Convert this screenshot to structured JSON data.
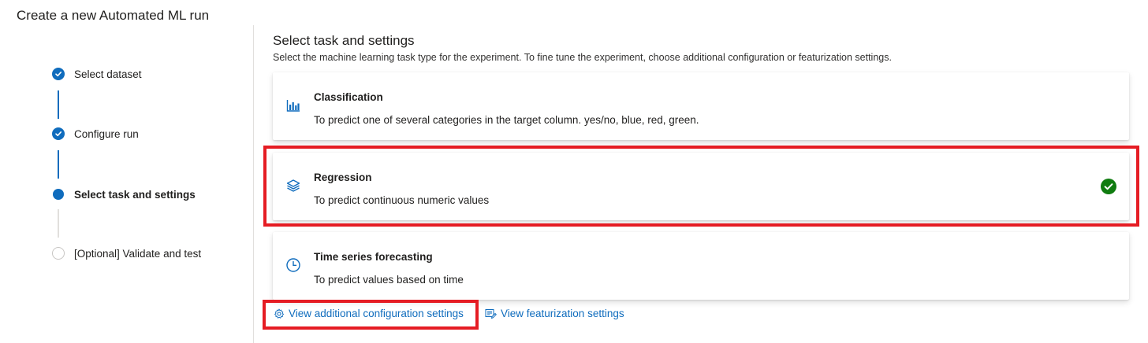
{
  "page": {
    "title": "Create a new Automated ML run"
  },
  "stepper": {
    "steps": [
      {
        "label": "Select dataset",
        "state": "done"
      },
      {
        "label": "Configure run",
        "state": "done"
      },
      {
        "label": "Select task and settings",
        "state": "current"
      },
      {
        "label": "[Optional] Validate and test",
        "state": "pending"
      }
    ]
  },
  "main": {
    "title": "Select task and settings",
    "description": "Select the machine learning task type for the experiment. To fine tune the experiment, choose additional configuration or featurization settings.",
    "tasks": [
      {
        "title": "Classification",
        "description": "To predict one of several categories in the target column. yes/no, blue, red, green.",
        "icon": "bar-chart-icon",
        "selected": false
      },
      {
        "title": "Regression",
        "description": "To predict continuous numeric values",
        "icon": "layers-icon",
        "selected": true
      },
      {
        "title": "Time series forecasting",
        "description": "To predict values based on time",
        "icon": "clock-icon",
        "selected": false
      }
    ],
    "links": {
      "config_label": "View additional configuration settings",
      "featurization_label": "View featurization settings"
    }
  },
  "colors": {
    "accent": "#0f6cbd",
    "success": "#107c10",
    "highlight": "#e51c23"
  }
}
